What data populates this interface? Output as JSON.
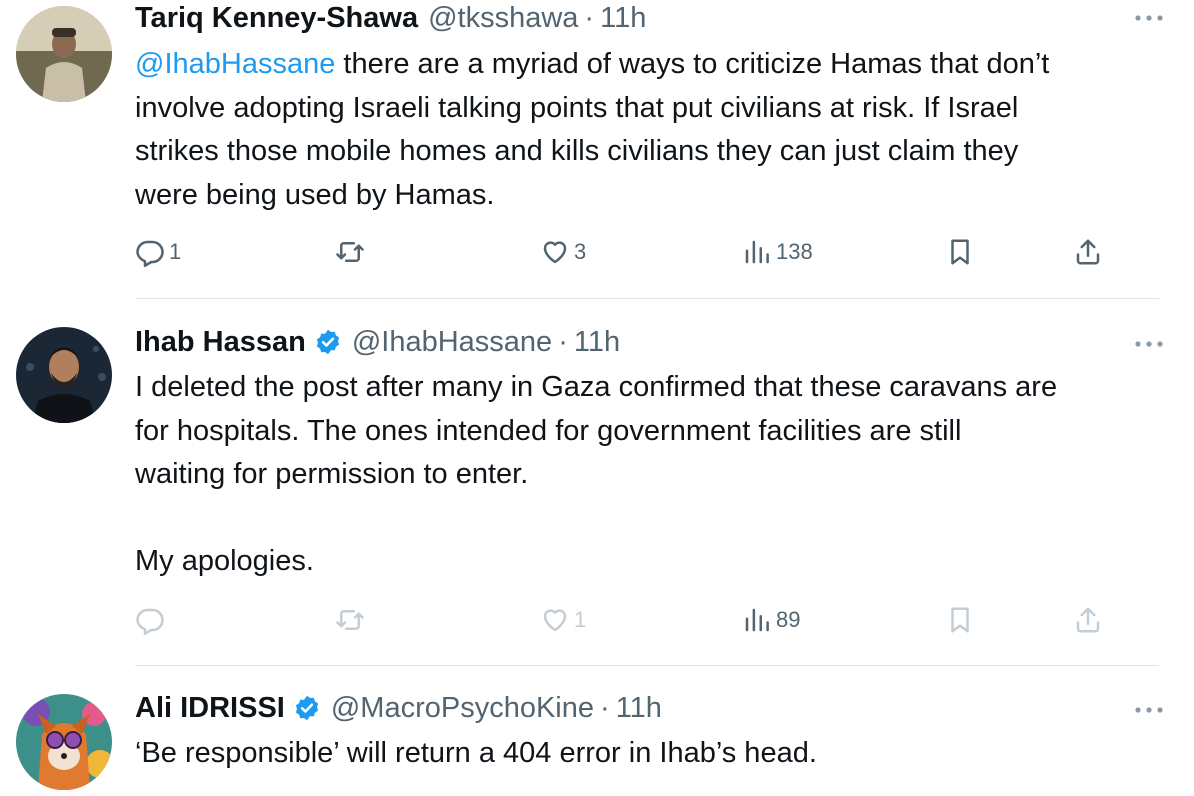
{
  "tweets": [
    {
      "name": "Tariq Kenney-Shawa",
      "verified": false,
      "handle": "@tksshawa",
      "time": "11h",
      "text_mention": "@IhabHassane",
      "text_l1": " there are a myriad of ways to criticize Hamas that don’t",
      "text_l2": "involve adopting Israeli talking points that put civilians at risk. If Israel",
      "text_l3": "strikes those mobile homes and kills civilians they can just claim they",
      "text_l4": "were being used by Hamas.",
      "replies": "1",
      "reposts": "",
      "likes": "3",
      "views": "138"
    },
    {
      "name": "Ihab Hassan",
      "verified": true,
      "handle": "@IhabHassane",
      "time": "11h",
      "text_l1": "I deleted the post after many in Gaza confirmed that these caravans are",
      "text_l2": "for hospitals. The ones intended for government facilities are still",
      "text_l3": "waiting for permission to enter.",
      "text_l4": "My apologies.",
      "replies": "",
      "reposts": "",
      "likes": "1",
      "views": "89"
    },
    {
      "name": "Ali IDRISSI",
      "verified": true,
      "handle": "@MacroPsychoKine",
      "time": "11h",
      "text_l1": "‘Be responsible’ will return a 404 error in Ihab’s head."
    }
  ],
  "separator": "·",
  "icons": {
    "more": "more-horizontal-icon",
    "reply": "reply-icon",
    "repost": "repost-icon",
    "like": "heart-icon",
    "views": "views-icon",
    "bookmark": "bookmark-icon",
    "share": "share-icon",
    "verified": "verified-badge-icon"
  },
  "colors": {
    "text": "#0f1419",
    "secondary": "#536471",
    "link": "#1d9bf0",
    "verified": "#1d9bf0",
    "faded_action": "#c3cdd5",
    "divider": "#e1e5e8"
  }
}
